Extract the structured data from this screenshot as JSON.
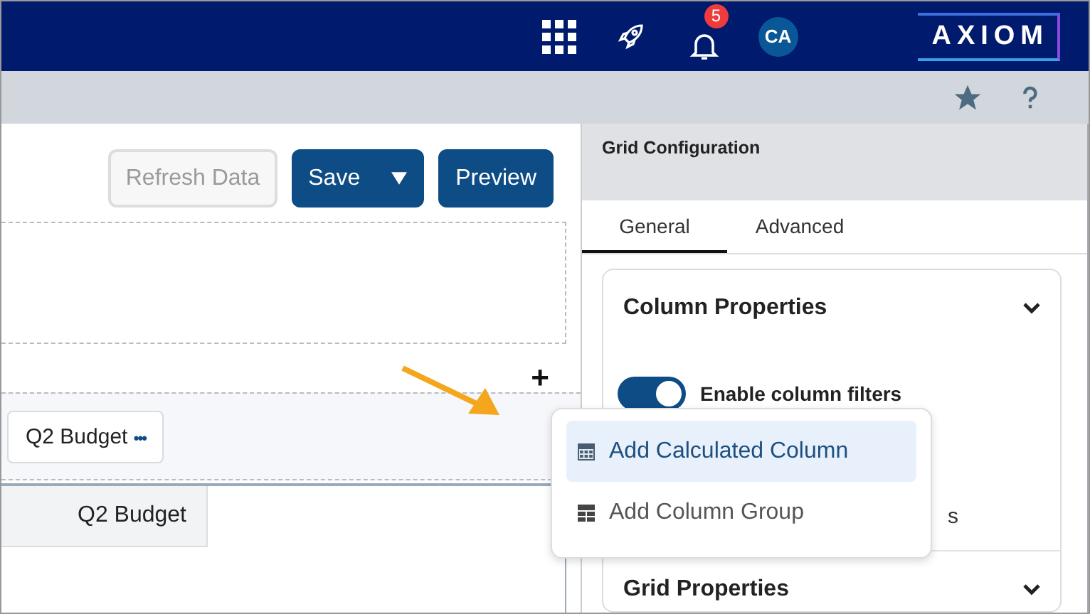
{
  "topbar": {
    "notification_count": "5",
    "avatar": "CA",
    "logo": "AXIOM"
  },
  "toolbar": {
    "buttons": [
      {
        "label": "Refresh Data",
        "disabled": true
      },
      {
        "label": "Save",
        "disabled": false,
        "dropdown": true
      },
      {
        "label": "Preview",
        "disabled": false,
        "dropdown": false
      }
    ]
  },
  "add_button": "+",
  "column_chip": {
    "label": "Q2 Budget",
    "more": "•••"
  },
  "table": {
    "columns": [
      "Q2 Budget"
    ]
  },
  "menu": {
    "items": [
      {
        "label": "Add Calculated Column",
        "selected": true,
        "kind": "calc"
      },
      {
        "label": "Add Column Group",
        "selected": false,
        "kind": "group"
      }
    ]
  },
  "panel": {
    "title": "Grid Configuration",
    "tabs": [
      {
        "label": "General",
        "selected": true
      },
      {
        "label": "Advanced",
        "selected": false
      }
    ],
    "sections": [
      {
        "title": "Column Properties",
        "options": [
          {
            "label": "Enable column filters",
            "kind": "toggle",
            "on": true
          },
          {
            "label": "s",
            "kind": "text"
          }
        ]
      },
      {
        "title": "Grid Properties"
      }
    ]
  }
}
